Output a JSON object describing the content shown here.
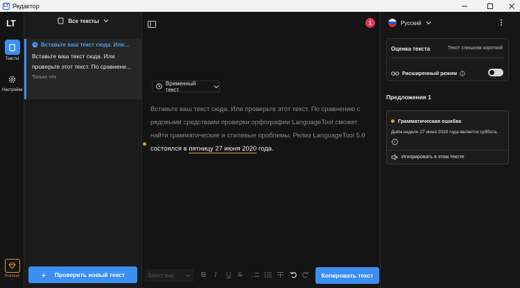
{
  "window": {
    "title": "Редактор",
    "app_icon": "languagetool-logo",
    "controls": [
      "minimize",
      "maximize",
      "close"
    ]
  },
  "rail": {
    "logo": "LT",
    "items": [
      {
        "label": "Тексты",
        "icon": "document-icon",
        "active": true
      },
      {
        "label": "Настройки",
        "icon": "gear-icon",
        "active": false
      }
    ],
    "premium_label": "Premium",
    "accent": "#3b8ff3",
    "premium_color": "#e2913a"
  },
  "list": {
    "header": "Все тексты",
    "documents": [
      {
        "title": "Вставьте ваш текст сюда. Или...",
        "excerpt_line1": "Вставьте ваш текст сюда. Или",
        "excerpt_line2": "проверьте этот текст. По сравнени...",
        "meta": "Только что"
      }
    ],
    "new_check_button": "Проверить новый текст"
  },
  "editor": {
    "error_count": "1",
    "temp_text_label": "Временный текст",
    "body": {
      "line1": "Вставьте ваш текст сюда. Или проверьте этот текст. По сравнению с",
      "line2": "рядовыми средствами проверки орфографии LanguageTool сможет",
      "line3": "найти грамматические и стилевые проблемы. Релиз LanguageTool 5.0",
      "line4_before": "состоялся в ",
      "line4_error": "пятницу 27 июня 2020",
      "line4_after": " года."
    },
    "toolbar": {
      "style_placeholder": "Select text",
      "buttons": [
        "bold",
        "italic",
        "underline",
        "strikethrough",
        "ordered-list",
        "bullet-list",
        "clear-format",
        "undo",
        "redo"
      ]
    },
    "copy_button": "Копировать текст"
  },
  "right": {
    "language": "Русский",
    "score_label": "Оценка текста",
    "score_value": "Текст слишком короткий",
    "advanced_mode": "Расширенный режим",
    "advanced_mode_on": false,
    "suggestions_label": "Предложения",
    "suggestions_count": "1",
    "suggestion": {
      "type": "Грамматическая ошибка",
      "message": "Днём недели 27 июня 2020 года является суббота.",
      "ignore": "Игнорировать в этом тексте"
    }
  }
}
